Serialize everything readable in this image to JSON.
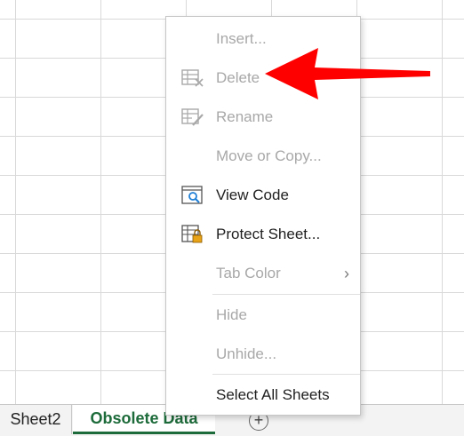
{
  "context_menu": {
    "items": [
      {
        "label": "Insert...",
        "enabled": false
      },
      {
        "label": "Delete",
        "enabled": false,
        "icon": "delete-sheet-icon"
      },
      {
        "label": "Rename",
        "enabled": false,
        "icon": "rename-sheet-icon"
      },
      {
        "label": "Move or Copy...",
        "enabled": false
      },
      {
        "label": "View Code",
        "enabled": true,
        "icon": "view-code-icon"
      },
      {
        "label": "Protect Sheet...",
        "enabled": true,
        "icon": "protect-sheet-icon"
      },
      {
        "label": "Tab Color",
        "enabled": false,
        "submenu": true
      },
      {
        "label": "Hide",
        "enabled": false
      },
      {
        "label": "Unhide...",
        "enabled": false
      },
      {
        "label": "Select All Sheets",
        "enabled": true
      }
    ]
  },
  "sheet_tabs": [
    {
      "label": "Sheet2",
      "active": false
    },
    {
      "label": "Obsolete Data",
      "active": true
    }
  ],
  "add_sheet_symbol": "+",
  "annotation": {
    "type": "red-arrow",
    "points_to": "Delete",
    "color": "#ff0000"
  },
  "colors": {
    "active_tab": "#1d6b3a",
    "disabled_text": "#a8a8a8",
    "arrow": "#ff0000"
  }
}
